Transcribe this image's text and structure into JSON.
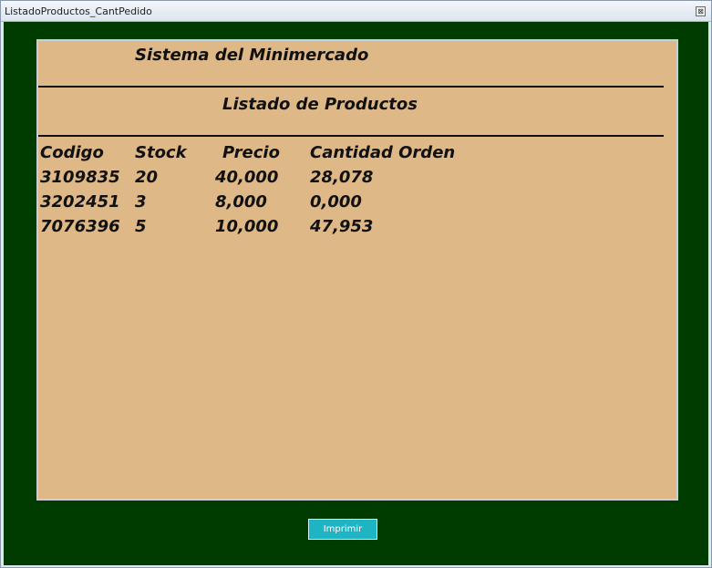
{
  "window": {
    "title": "ListadoProductos_CantPedido",
    "close_glyph": "⊠"
  },
  "report": {
    "system_title": "Sistema del Minimercado",
    "list_title": "Listado de Productos",
    "columns": [
      "Codigo",
      "Stock",
      "Precio",
      "Cantidad Orden"
    ],
    "rows": [
      [
        "3109835",
        "20",
        "40,000",
        "28,078"
      ],
      [
        "3202451",
        "3",
        "8,000",
        "0,000"
      ],
      [
        "7076396",
        "5",
        "10,000",
        "47,953"
      ]
    ]
  },
  "buttons": {
    "print_label": "Imprimir"
  },
  "colors": {
    "background": "#003c00",
    "report": "#dfb887",
    "button": "#1eb4c4"
  }
}
